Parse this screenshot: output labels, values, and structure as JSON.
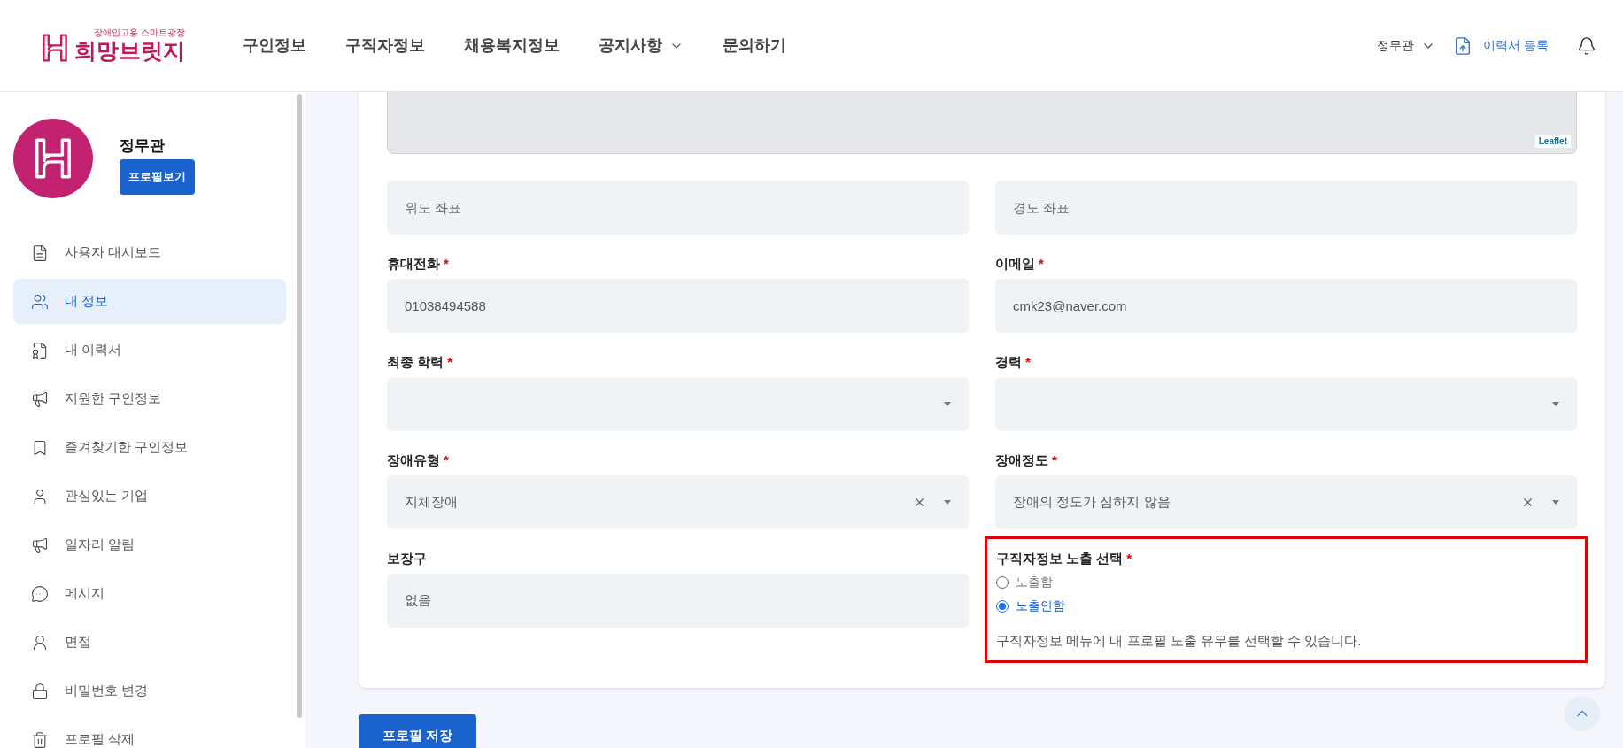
{
  "header": {
    "logo": {
      "tagline": "장애인고용 스마트광장",
      "name": "희망브릿지"
    },
    "nav": [
      {
        "label": "구인정보",
        "has_menu": false
      },
      {
        "label": "구직자정보",
        "has_menu": false
      },
      {
        "label": "채용복지정보",
        "has_menu": false
      },
      {
        "label": "공지사항",
        "has_menu": true
      },
      {
        "label": "문의하기",
        "has_menu": false
      }
    ],
    "user_menu": "정무관",
    "resume_button": "이력서 등록"
  },
  "sidebar": {
    "profile": {
      "name": "정무관",
      "button": "프로필보기"
    },
    "items": [
      {
        "label": "사용자 대시보드",
        "selected": false
      },
      {
        "label": "내 정보",
        "selected": true
      },
      {
        "label": "내 이력서",
        "selected": false
      },
      {
        "label": "지원한 구인정보",
        "selected": false
      },
      {
        "label": "즐겨찾기한 구인정보",
        "selected": false
      },
      {
        "label": "관심있는 기업",
        "selected": false
      },
      {
        "label": "일자리 알림",
        "selected": false
      },
      {
        "label": "메시지",
        "selected": false
      },
      {
        "label": "면접",
        "selected": false
      },
      {
        "label": "비밀번호 변경",
        "selected": false
      },
      {
        "label": "프로필 삭제",
        "selected": false
      }
    ]
  },
  "map": {
    "attribution": "Leaflet"
  },
  "fields": [
    {
      "kind": "text",
      "placeholder": "위도 좌표"
    },
    {
      "kind": "text",
      "placeholder": "경도 좌표"
    },
    {
      "kind": "text",
      "label": "휴대전화",
      "mark": "*",
      "value": "01038494588"
    },
    {
      "kind": "text",
      "label": "이메일",
      "mark": "*",
      "value": "cmk23@naver.com"
    },
    {
      "kind": "select",
      "label": "최종 학력",
      "mark": "*"
    },
    {
      "kind": "select",
      "label": "경력",
      "mark": "*"
    },
    {
      "kind": "select",
      "label": "장애유형",
      "mark": "*",
      "value": "지체장애",
      "clearable": true
    },
    {
      "kind": "select",
      "label": "장애정도",
      "mark": "*",
      "value": "장애의 정도가 심하지 않음",
      "clearable": true
    },
    {
      "kind": "text",
      "label": "보장구",
      "value": "없음"
    },
    {
      "kind": "radio",
      "label": "구직자정보 노출 선택",
      "mark": "*",
      "highlighted": true,
      "options": [
        {
          "label": "노출함",
          "selected": false
        },
        {
          "label": "노출안함",
          "selected": true
        }
      ],
      "help": "구직자정보 메뉴에 내 프로필 노출 유무를 선택할 수 있습니다."
    }
  ],
  "save_button": "프로필 저장"
}
